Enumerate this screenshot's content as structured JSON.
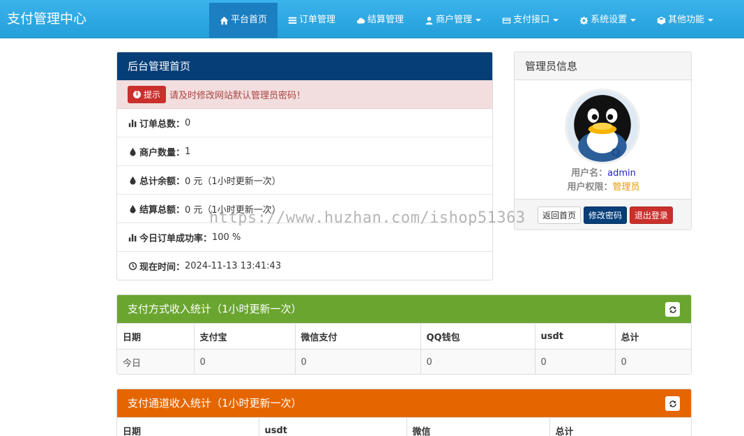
{
  "navbar": {
    "brand": "支付管理中心",
    "items": [
      {
        "label": "平台首页",
        "icon": "home-icon",
        "active": true
      },
      {
        "label": "订单管理",
        "icon": "list-icon"
      },
      {
        "label": "结算管理",
        "icon": "cloud-icon"
      },
      {
        "label": "商户管理",
        "icon": "user-icon",
        "dropdown": true
      },
      {
        "label": "支付接口",
        "icon": "credit-card-icon",
        "dropdown": true
      },
      {
        "label": "系统设置",
        "icon": "gear-icon",
        "dropdown": true
      },
      {
        "label": "其他功能",
        "icon": "cube-icon",
        "dropdown": true
      }
    ]
  },
  "main_panel": {
    "title": "后台管理首页",
    "tip_badge": "提示",
    "tip_text": "请及时修改网站默认管理员密码！",
    "stats": [
      {
        "icon": "bar-chart-icon",
        "label": "订单总数：",
        "value": "0"
      },
      {
        "icon": "tint-icon",
        "label": "商户数量：",
        "value": "1"
      },
      {
        "icon": "tint-icon",
        "label": "总计余额：",
        "value": "0 元（1小时更新一次）"
      },
      {
        "icon": "tint-icon",
        "label": "结算总额：",
        "value": "0 元（1小时更新一次）"
      },
      {
        "icon": "bar-chart-icon",
        "label": "今日订单成功率：",
        "value": "100 %"
      },
      {
        "icon": "clock-icon",
        "label": "现在时间：",
        "value": " 2024-11-13 13:41:43"
      }
    ]
  },
  "admin_panel": {
    "title": "管理员信息",
    "username_label": "用户名：",
    "username": "admin",
    "role_label": "用户权限：",
    "role": "管理员",
    "buttons": {
      "home": "返回首页",
      "change_password": "修改密码",
      "logout": "退出登录"
    }
  },
  "pay_method_stats": {
    "title": "支付方式收入统计（1小时更新一次）",
    "columns": [
      "日期",
      "支付宝",
      "微信支付",
      "QQ钱包",
      "usdt",
      "总计"
    ],
    "rows": [
      [
        "今日",
        "0",
        "0",
        "0",
        "0",
        "0"
      ]
    ]
  },
  "channel_stats": {
    "title": "支付通道收入统计（1小时更新一次）",
    "columns": [
      "日期",
      "usdt",
      "微信",
      "总计"
    ]
  },
  "watermark": "https://www.huzhan.com/ishop51363",
  "colors": {
    "navbar": "#239fd9",
    "nav_active": "#1b7fc1",
    "main_heading": "#063e78",
    "pay_method_heading": "#6aa530",
    "channel_heading": "#e56600",
    "danger": "#c9302c"
  }
}
